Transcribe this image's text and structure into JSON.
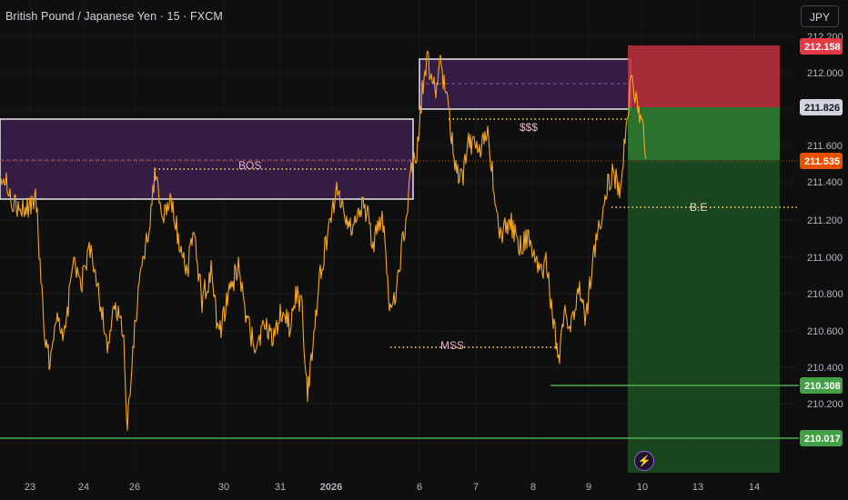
{
  "header": {
    "title": "British Pound / Japanese Yen · 15 · FXCM",
    "currency_button": "JPY"
  },
  "icons": {
    "flash": "lightning-icon"
  },
  "colors": {
    "price_line": "#f5a623",
    "order_block_fill": "#3b1f4e",
    "stop_zone": "#c1303d",
    "target_zone": "#2e7d32",
    "horizontal_level": "#4caf50",
    "annotation_line": "#ffe066",
    "current_price_badge": "#e65100"
  },
  "price_axis": {
    "ticks": [
      "212.200",
      "212.000",
      "211.800",
      "211.600",
      "211.400",
      "211.200",
      "211.000",
      "210.800",
      "210.600",
      "210.400",
      "210.200"
    ],
    "badges": [
      {
        "label": "212.158",
        "type": "stop"
      },
      {
        "label": "211.826",
        "type": "entry"
      },
      {
        "label": "211.535",
        "type": "current"
      },
      {
        "label": "210.308",
        "type": "level"
      },
      {
        "label": "210.017",
        "type": "level"
      }
    ]
  },
  "time_axis": {
    "labels": [
      "23",
      "24",
      "26",
      "30",
      "31",
      "2026",
      "6",
      "7",
      "8",
      "9",
      "10",
      "13",
      "14"
    ]
  },
  "annotations": {
    "bos": "BOS",
    "sss": "$$$",
    "mss": "MSS",
    "be": "B.E"
  }
}
